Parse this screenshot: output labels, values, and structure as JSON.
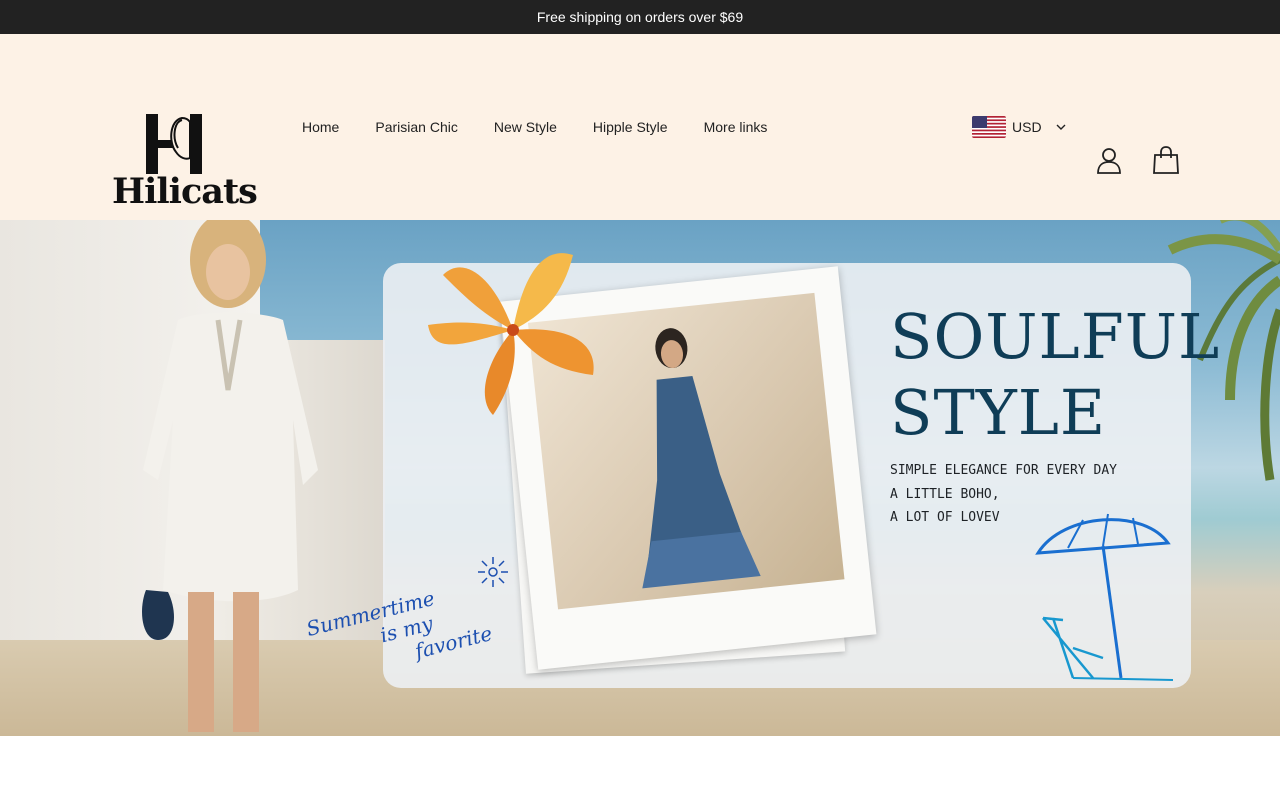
{
  "announcement": "Free shipping on orders over $69",
  "brand": {
    "name": "Hilicats"
  },
  "nav": {
    "items": [
      "Home",
      "Parisian Chic",
      "New Style",
      "Hipple Style",
      "More links"
    ]
  },
  "currency": {
    "code": "USD",
    "flag": "us-flag-icon"
  },
  "icons": {
    "account": "account-icon",
    "cart": "cart-icon",
    "chevron": "chevron-down-icon"
  },
  "hero": {
    "title_line1": "SOULFUL",
    "title_line2": "STYLE",
    "tagline": [
      "Simple elegance for every day",
      "a little boho,",
      "a lot of lovev"
    ],
    "script_line1": "Summertime",
    "script_line2": "is my",
    "script_line3": "favorite"
  },
  "colors": {
    "announcement_bg": "#222222",
    "header_bg": "#fdf2e6",
    "title": "#0f3d57",
    "script": "#1c4fb0"
  }
}
